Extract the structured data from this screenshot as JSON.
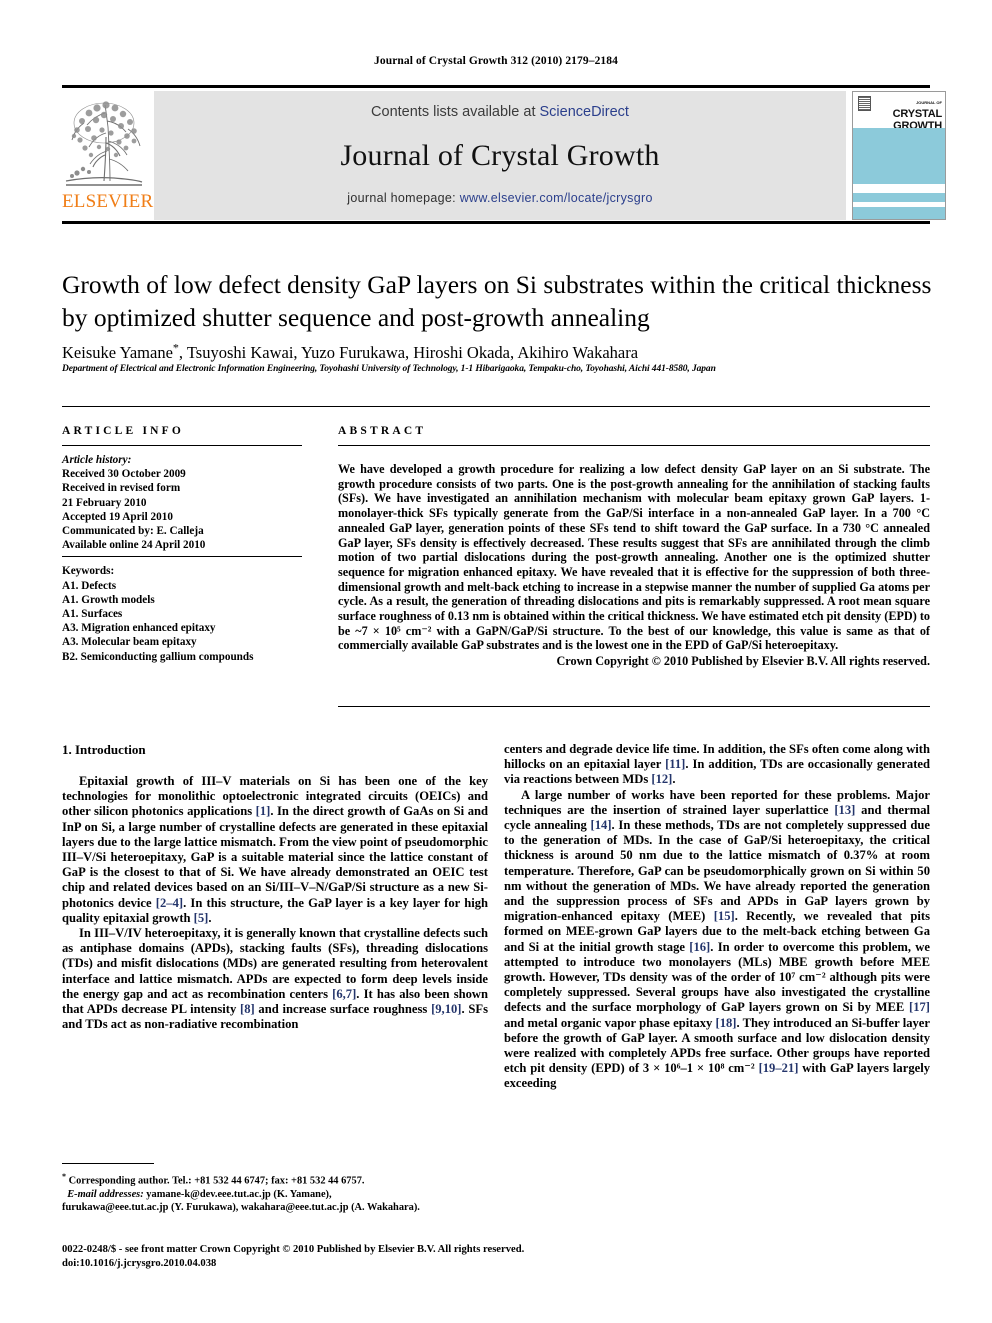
{
  "running_head": "Journal of Crystal Growth 312 (2010) 2179–2184",
  "header": {
    "contents_prefix": "Contents lists available at ",
    "sciencedirect": "ScienceDirect",
    "journal_title": "Journal of Crystal Growth",
    "homepage_prefix": "journal homepage: ",
    "homepage_url": "www.elsevier.com/locate/jcrysgro",
    "publisher_name": "ELSEVIER",
    "cover": {
      "small_label": "JOURNAL OF",
      "line1": "CRYSTAL",
      "line2": "GROWTH",
      "band_color": "#8ccada"
    },
    "link_color": "#2b3f8c",
    "elsevier_orange": "#f07e17",
    "band_grey": "#e3e3e3"
  },
  "article": {
    "title": "Growth of low defect density GaP layers on Si substrates within the critical thickness by optimized shutter sequence and post-growth annealing",
    "authors": "Keisuke Yamane *, Tsuyoshi Kawai, Yuzo Furukawa, Hiroshi Okada, Akihiro Wakahara",
    "affiliation": "Department of Electrical and Electronic Information Engineering, Toyohashi University of Technology, 1-1 Hibarigaoka, Tempaku-cho, Toyohashi, Aichi 441-8580, Japan"
  },
  "info": {
    "heading": "ARTICLE INFO",
    "history_label": "Article history:",
    "history": [
      "Received 30 October 2009",
      "Received in revised form",
      "21 February 2010",
      "Accepted 19 April 2010",
      "Communicated by: E. Calleja",
      "Available online 24 April 2010"
    ],
    "keywords_label": "Keywords:",
    "keywords": [
      "A1. Defects",
      "A1. Growth models",
      "A1. Surfaces",
      "A3. Migration enhanced epitaxy",
      "A3. Molecular beam epitaxy",
      "B2. Semiconducting gallium compounds"
    ]
  },
  "abstract": {
    "heading": "ABSTRACT",
    "text": "We have developed a growth procedure for realizing a low defect density GaP layer on an Si substrate. The growth procedure consists of two parts. One is the post-growth annealing for the annihilation of stacking faults (SFs). We have investigated an annihilation mechanism with molecular beam epitaxy grown GaP layers. 1-monolayer-thick SFs typically generate from the GaP/Si interface in a non-annealed GaP layer. In a 700 °C annealed GaP layer, generation points of these SFs tend to shift toward the GaP surface. In a 730 °C annealed GaP layer, SFs density is effectively decreased. These results suggest that SFs are annihilated through the climb motion of two partial dislocations during the post-growth annealing. Another one is the optimized shutter sequence for migration enhanced epitaxy. We have revealed that it is effective for the suppression of both three-dimensional growth and melt-back etching to increase in a stepwise manner the number of supplied Ga atoms per cycle. As a result, the generation of threading dislocations and pits is remarkably suppressed. A root mean square surface roughness of 0.13 nm is obtained within the critical thickness. We have estimated etch pit density (EPD) to be ~7 × 10⁵ cm⁻² with a GaPN/GaP/Si structure. To the best of our knowledge, this value is same as that of commercially available GaP substrates and is the lowest one in the EPD of GaP/Si heteroepitaxy.",
    "copyright": "Crown Copyright © 2010 Published by Elsevier B.V. All rights reserved."
  },
  "body": {
    "section_heading": "1. Introduction",
    "left_paragraphs": [
      "Epitaxial growth of III–V materials on Si has been one of the key technologies for monolithic optoelectronic integrated circuits (OEICs) and other silicon photonics applications [1]. In the direct growth of GaAs on Si and InP on Si, a large number of crystalline defects are generated in these epitaxial layers due to the large lattice mismatch. From the view point of pseudomorphic III–V/Si heteroepitaxy, GaP is a suitable material since the lattice constant of GaP is the closest to that of Si. We have already demonstrated an OEIC test chip and related devices based on an Si/III–V–N/GaP/Si structure as a new Si-photonics device [2–4]. In this structure, the GaP layer is a key layer for high quality epitaxial growth [5].",
      "In III–V/IV heteroepitaxy, it is generally known that crystalline defects such as antiphase domains (APDs), stacking faults (SFs), threading dislocations (TDs) and misfit dislocations (MDs) are generated resulting from heterovalent interface and lattice mismatch. APDs are expected to form deep levels inside the energy gap and act as recombination centers [6,7]. It has also been shown that APDs decrease PL intensity [8] and increase surface roughness [9,10]. SFs and TDs act as non-radiative recombination"
    ],
    "right_paragraphs": [
      "centers and degrade device life time. In addition, the SFs often come along with hillocks on an epitaxial layer [11]. In addition, TDs are occasionally generated via reactions between MDs [12].",
      "A large number of works have been reported for these problems. Major techniques are the insertion of strained layer superlattice [13] and thermal cycle annealing [14]. In these methods, TDs are not completely suppressed due to the generation of MDs. In the case of GaP/Si heteroepitaxy, the critical thickness is around 50 nm due to the lattice mismatch of 0.37% at room temperature. Therefore, GaP can be pseudomorphically grown on Si within 50 nm without the generation of MDs. We have already reported the generation and the suppression process of SFs and APDs in GaP layers grown by migration-enhanced epitaxy (MEE) [15]. Recently, we revealed that pits formed on MEE-grown GaP layers due to the melt-back etching between Ga and Si at the initial growth stage [16]. In order to overcome this problem, we attempted to introduce two monolayers (MLs) MBE growth before MEE growth. However, TDs density was of the order of 10⁷ cm⁻² although pits were completely suppressed. Several groups have also investigated the crystalline defects and the surface morphology of GaP layers grown on Si by MEE [17] and metal organic vapor phase epitaxy [18]. They introduced an Si-buffer layer before the growth of GaP layer. A smooth surface and low dislocation density were realized with completely APDs free surface. Other groups have reported etch pit density (EPD) of 3 × 10⁶–1 × 10⁸ cm⁻² [19–21] with GaP layers largely exceeding"
    ]
  },
  "footnote": {
    "corresponding": "Corresponding author. Tel.: +81 532 44 6747; fax: +81 532 44 6757.",
    "email_label": "E-mail addresses:",
    "emails_line1": "yamane-k@dev.eee.tut.ac.jp (K. Yamane),",
    "emails_line2": "furukawa@eee.tut.ac.jp (Y. Furukawa), wakahara@eee.tut.ac.jp (A. Wakahara)."
  },
  "colophon": {
    "line1": "0022-0248/$ - see front matter Crown Copyright © 2010 Published by Elsevier B.V. All rights reserved.",
    "line2": "doi:10.1016/j.jcrysgro.2010.04.038"
  }
}
